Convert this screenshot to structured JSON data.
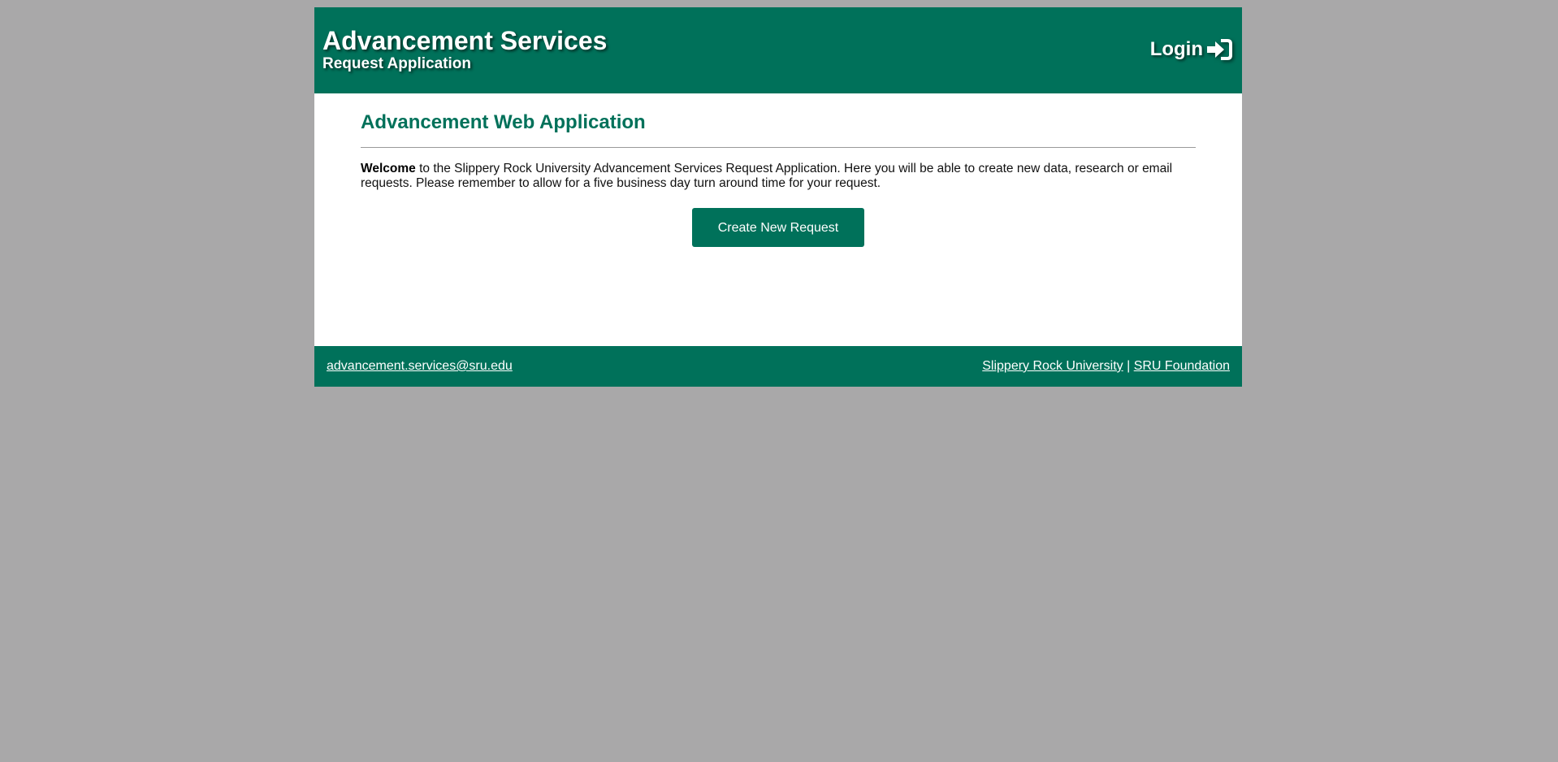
{
  "header": {
    "title": "Advancement Services",
    "subtitle": "Request Application",
    "login_label": "Login",
    "login_icon": "sign-in-icon"
  },
  "main": {
    "heading": "Advancement Web Application",
    "welcome_bold": "Welcome",
    "welcome_text": " to the Slippery Rock University Advancement Services Request Application. Here you will be able to create new data, research or email requests. Please remember to allow for a five business day turn around time for your request.",
    "create_button_label": "Create New Request"
  },
  "footer": {
    "email": "advancement.services@sru.edu",
    "link_university": "Slippery Rock University",
    "separator": "|",
    "link_foundation": "SRU Foundation"
  },
  "colors": {
    "brand_green": "#00715a",
    "page_background": "#a9a8a9",
    "content_background": "#ffffff"
  }
}
